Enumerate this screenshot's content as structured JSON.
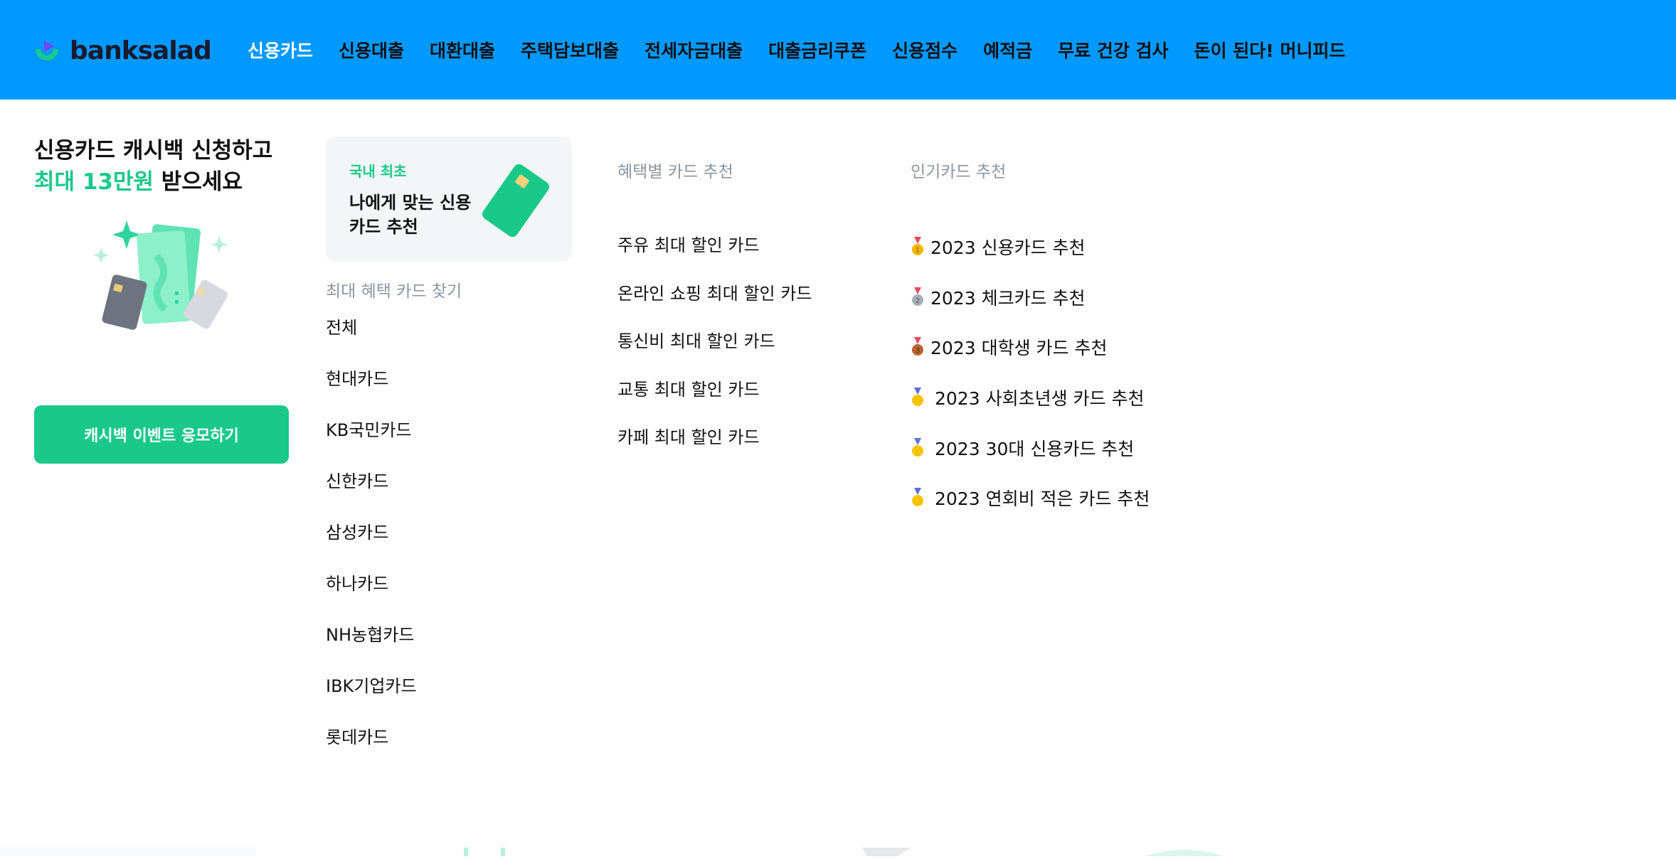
{
  "brand": {
    "name": "banksalad",
    "header_color": "#0099FF",
    "accent_color": "#1AC98A",
    "logo_icon": "banksalad-logo-icon"
  },
  "nav": {
    "items": [
      {
        "label": "신용카드",
        "active": true
      },
      {
        "label": "신용대출"
      },
      {
        "label": "대환대출"
      },
      {
        "label": "주택담보대출"
      },
      {
        "label": "전세자금대출"
      },
      {
        "label": "대출금리쿠폰"
      },
      {
        "label": "신용점수"
      },
      {
        "label": "예적금"
      },
      {
        "label": "무료 건강 검사"
      },
      {
        "label": "돈이 된다! 머니피드"
      }
    ]
  },
  "promo": {
    "title_line1": "신용카드 캐시백 신청하고",
    "title_highlight": "최대 13만원",
    "title_rest": " 받으세요",
    "button_label": "캐시백 이벤트 응모하기",
    "illustration_icon": "cards-sparkle-icon"
  },
  "recommend_box": {
    "tag": "국내 최초",
    "text": "나에게 맞는 신용카드 추천",
    "icon": "credit-card-icon"
  },
  "issuers": {
    "heading": "최대 혜택 카드 찾기",
    "items": [
      "전체",
      "현대카드",
      "KB국민카드",
      "신한카드",
      "삼성카드",
      "하나카드",
      "NH농협카드",
      "IBK기업카드",
      "롯데카드"
    ]
  },
  "benefits": {
    "heading": "혜택별 카드 추천",
    "items": [
      "주유 최대 할인 카드",
      "온라인 쇼핑 최대 할인 카드",
      "통신비 최대 할인 카드",
      "교통 최대 할인 카드",
      "카페 최대 할인 카드"
    ]
  },
  "popular": {
    "heading": "인기카드 추천",
    "items": [
      {
        "label": "2023 신용카드 추천",
        "medal": "gold-medal-icon"
      },
      {
        "label": "2023 체크카드 추천",
        "medal": "silver-medal-icon"
      },
      {
        "label": "2023 대학생 카드 추천",
        "medal": "bronze-medal-icon"
      },
      {
        "label": "2023 사회초년생 카드 추천",
        "medal": "medal-icon"
      },
      {
        "label": "2023 30대 신용카드 추천",
        "medal": "medal-icon"
      },
      {
        "label": "2023 연회비 적은 카드 추천",
        "medal": "medal-icon"
      }
    ]
  }
}
